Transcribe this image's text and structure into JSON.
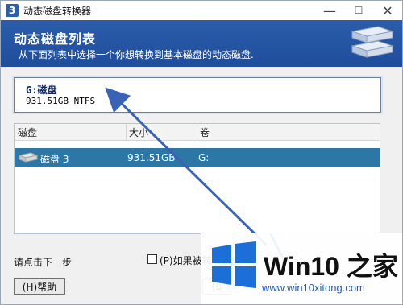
{
  "window": {
    "title": "动态磁盘转换器",
    "controls": {
      "minimize": "—",
      "maximize": "☐",
      "close": "✕"
    }
  },
  "header": {
    "title": "动态磁盘列表",
    "subtitle": "从下面列表中选择一个你想转换到基本磁盘的动态磁盘."
  },
  "selected": {
    "name": "G:磁盘",
    "info": "931.51GB NTFS"
  },
  "list": {
    "columns": [
      "磁盘",
      "大小",
      "卷"
    ],
    "rows": [
      {
        "disk": "磁盘 3",
        "size": "931.51GB",
        "volume": "G:"
      }
    ]
  },
  "footer": {
    "hint": "请点击下一步",
    "checkbox_label": "(P)如果被转转磁盘",
    "help_button": "(H)帮助",
    "next_button": "(B"
  },
  "watermark": {
    "brand": "Win10 之家",
    "url": "www.win10xitong.com"
  },
  "colors": {
    "header_bg": "#2b5daa",
    "selected_row": "#2c77a6",
    "arrow": "#3b63b5"
  }
}
